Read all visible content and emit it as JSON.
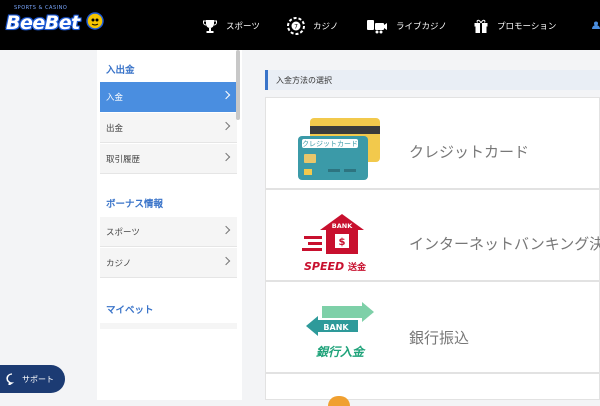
{
  "header": {
    "logo_text": "BeeBet",
    "logo_sub": "SPORTS & CASINO",
    "nav": [
      {
        "label": "スポーツ",
        "icon": "trophy-icon"
      },
      {
        "label": "カジノ",
        "icon": "casino-chip-icon"
      },
      {
        "label": "ライブカジノ",
        "icon": "live-casino-icon"
      },
      {
        "label": "プロモーション",
        "icon": "gift-icon"
      }
    ],
    "user_icon": "user-icon"
  },
  "sidebar": {
    "groups": [
      {
        "title": "入出金",
        "items": [
          {
            "label": "入金",
            "active": true
          },
          {
            "label": "出金"
          },
          {
            "label": "取引履歴"
          }
        ]
      },
      {
        "title": "ボーナス情報",
        "items": [
          {
            "label": "スポーツ"
          },
          {
            "label": "カジノ"
          }
        ]
      },
      {
        "title": "マイベット",
        "items": []
      }
    ]
  },
  "main": {
    "section_title": "入金方法の選択",
    "methods": [
      {
        "label": "クレジットカード",
        "card_label": "クレジットカード",
        "icon": "credit-card-icon"
      },
      {
        "label": "インターネットバンキング決",
        "bank_label": "BANK",
        "speed_label": "SPEED",
        "speed_suffix": "送金",
        "icon": "speed-bank-icon"
      },
      {
        "label": "銀行振込",
        "bank_label": "BANK",
        "caption": "銀行入金",
        "icon": "bank-transfer-icon"
      }
    ]
  },
  "support": {
    "label": "サポート",
    "icon": "chat-icon"
  },
  "colors": {
    "accent": "#3a74c9",
    "active": "#4a8ee0",
    "topbar": "#000000",
    "support": "#1c3b73"
  }
}
